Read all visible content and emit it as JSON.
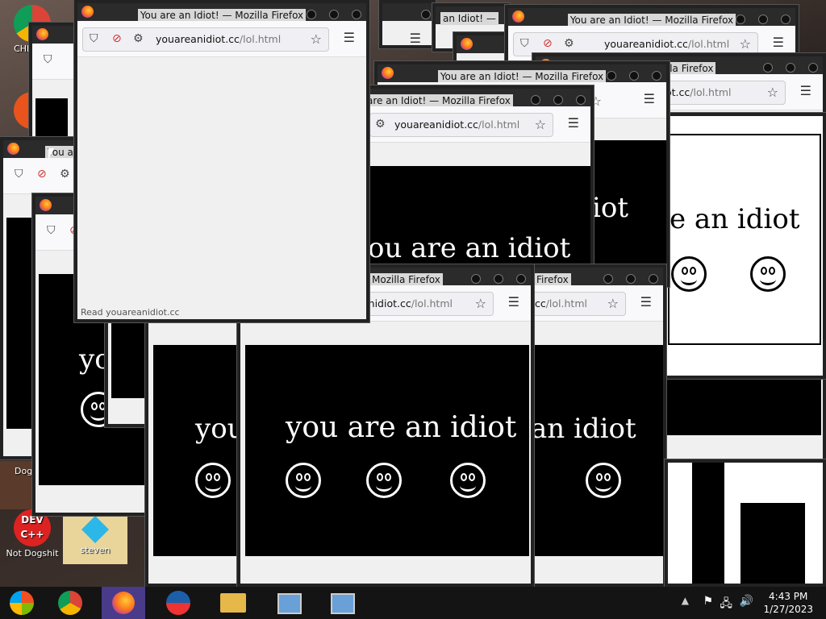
{
  "window": {
    "title": "You are an Idiot! — Mozilla Firefox",
    "title_partial_1": "are an Idiot! — Mozilla Firefox",
    "title_partial_2": "Mozilla Firefox",
    "title_partial_3": "Firefox",
    "title_partial_4": "You are",
    "title_partial_5": "an Idiot! —",
    "title_partial_6": "You are an Idiot! — Mozilla Firefox"
  },
  "url": {
    "domain": "youareanidiot.cc",
    "path": "/lol.html",
    "partial_domain": "youareanidiot.cc",
    "partial_domain_2": "anidiot.cc",
    "partial_domain_3": ".cc",
    "partial_domain_4": "ot.cc"
  },
  "content": {
    "slogan": "you are an idiot",
    "slogan_fragment_1": "you",
    "slogan_fragment_2": "yo",
    "slogan_fragment_3": "an idiot",
    "slogan_fragment_4": "iot",
    "slogan_fragment_5": "e an idiot",
    "slogan_fragment_6": "ou are an idiot"
  },
  "status_bar": "Read youareanidiot.cc",
  "desktop_icons": [
    {
      "label": "CHR DIS",
      "name": "chrome"
    },
    {
      "label": "Dog",
      "name": "dog"
    },
    {
      "label": "Not Dogshit",
      "name": "dev-cpp",
      "badge": "DEV C++"
    },
    {
      "label": "steven",
      "name": "steven"
    }
  ],
  "taskbar": {
    "time": "4:43 PM",
    "date": "1/27/2023"
  },
  "colors": {
    "titlebar": "#2b2b2b",
    "page_black": "#000000",
    "text_white": "#ffffff"
  }
}
